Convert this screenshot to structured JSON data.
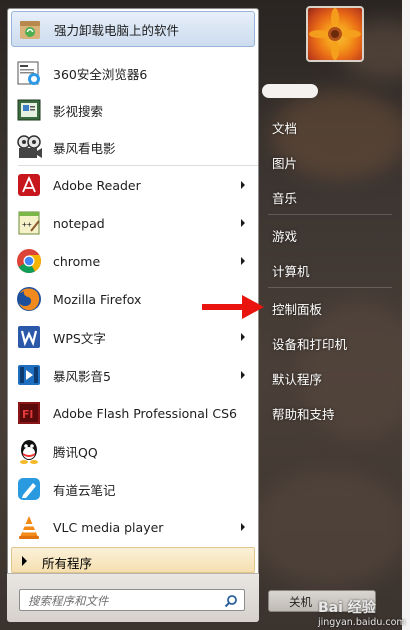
{
  "pinned": [
    {
      "label": "强力卸载电脑上的软件",
      "icon": "uninstaller-icon",
      "highlighted": true
    },
    {
      "label": "360安全浏览器6",
      "icon": "360-browser-icon"
    },
    {
      "label": "影视搜索",
      "icon": "video-search-icon"
    },
    {
      "label": "暴风看电影",
      "icon": "storm-movie-icon"
    }
  ],
  "recent": [
    {
      "label": "Adobe Reader",
      "icon": "adobe-reader-icon",
      "has_submenu": true
    },
    {
      "label": "notepad",
      "icon": "notepad-icon",
      "has_submenu": true
    },
    {
      "label": "chrome",
      "icon": "chrome-icon",
      "has_submenu": true
    },
    {
      "label": "Mozilla Firefox",
      "icon": "firefox-icon",
      "has_submenu": false
    },
    {
      "label": "WPS文字",
      "icon": "wps-writer-icon",
      "has_submenu": true
    },
    {
      "label": "暴风影音5",
      "icon": "storm-player-icon",
      "has_submenu": true
    },
    {
      "label": "Adobe Flash Professional CS6",
      "icon": "adobe-flash-icon",
      "has_submenu": false
    },
    {
      "label": "腾讯QQ",
      "icon": "qq-icon",
      "has_submenu": false
    },
    {
      "label": "有道云笔记",
      "icon": "youdao-note-icon",
      "has_submenu": false
    },
    {
      "label": "VLC media player",
      "icon": "vlc-icon",
      "has_submenu": true
    }
  ],
  "all_programs": "所有程序",
  "search": {
    "placeholder": "搜索程序和文件"
  },
  "right_menu": {
    "documents": "文档",
    "pictures": "图片",
    "music": "音乐",
    "games": "游戏",
    "computer": "计算机",
    "control_panel": "控制面板",
    "devices_printers": "设备和打印机",
    "default_programs": "默认程序",
    "help_support": "帮助和支持"
  },
  "shutdown_label": "关机",
  "watermark": {
    "brand": "Bai 经验",
    "site": "jingyan.baidu.com"
  }
}
